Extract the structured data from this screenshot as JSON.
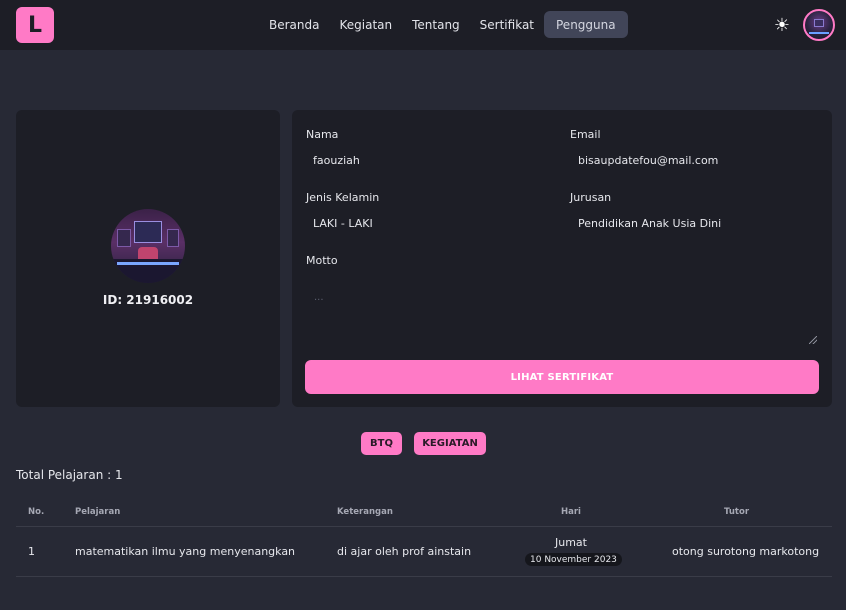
{
  "nav": {
    "logo": "L",
    "links": [
      "Beranda",
      "Kegiatan",
      "Tentang",
      "Sertifikat",
      "Pengguna"
    ],
    "active": "Pengguna",
    "theme_icon": "sun-icon"
  },
  "profile": {
    "id_text": "ID: 21916002"
  },
  "info": {
    "nama_label": "Nama",
    "nama_value": "faouziah",
    "email_label": "Email",
    "email_value": "bisaupdatefou@mail.com",
    "gender_label": "Jenis Kelamin",
    "gender_value": "LAKI - LAKI",
    "jurusan_label": "Jurusan",
    "jurusan_value": "Pendidikan Anak Usia Dini",
    "motto_label": "Motto",
    "motto_placeholder": "...",
    "cert_button": "LIHAT SERTIFIKAT"
  },
  "tabs": [
    "BTQ",
    "KEGIATAN"
  ],
  "total_text": "Total Pelajaran : 1",
  "table": {
    "headers": [
      "No.",
      "Pelajaran",
      "Keterangan",
      "Hari",
      "Tutor"
    ],
    "rows": [
      {
        "no": "1",
        "pelajaran": "matematikan ilmu yang menyenangkan",
        "keterangan": "di ajar oleh prof ainstain",
        "hari": "Jumat",
        "tanggal": "10 November 2023",
        "tutor": "otong surotong markotong"
      }
    ]
  },
  "colors": {
    "accent": "#ff7ac6",
    "background": "#272935",
    "card": "#1d1e26"
  }
}
